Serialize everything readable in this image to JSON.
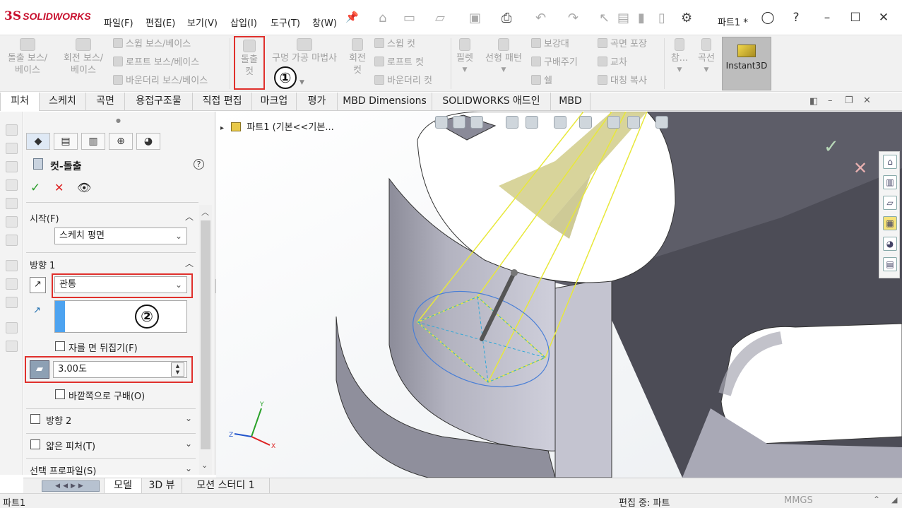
{
  "app": {
    "brand_mark": "3S",
    "brand_name": "SOLIDWORKS",
    "doc_title": "파트1 *"
  },
  "menu": [
    "파일(F)",
    "편집(E)",
    "보기(V)",
    "삽입(I)",
    "도구(T)",
    "창(W)"
  ],
  "ribbon": {
    "boss_extrude": [
      "돌출 보스/",
      "베이스"
    ],
    "boss_revolve": [
      "회전 보스/",
      "베이스"
    ],
    "sweep_boss": "스윕 보스/베이스",
    "loft_boss": "로프트 보스/베이스",
    "boundary_boss": "바운더리 보스/베이스",
    "cut_extrude": [
      "돌출",
      "컷"
    ],
    "hole_wizard": [
      "구멍 가공 마법사"
    ],
    "cut_revolve": [
      "회전",
      "컷"
    ],
    "sweep_cut": "스윕 컷",
    "loft_cut": "로프트 컷",
    "boundary_cut": "바운더리 컷",
    "fillet": "필렛",
    "linear_pattern": "선형 패턴",
    "rib": "보강대",
    "draft": "구배주기",
    "shell": "쉘",
    "wrap": "곡면 포장",
    "intersect": "교차",
    "mirror": "대칭 복사",
    "reference": "참...",
    "curves": "곡선",
    "instant3d": "Instant3D",
    "callout_1": "①"
  },
  "tabs": [
    "피처",
    "스케치",
    "곡면",
    "용접구조물",
    "직접 편집",
    "마크업",
    "평가",
    "MBD Dimensions",
    "SOLIDWORKS 애드인",
    "MBD"
  ],
  "property_manager": {
    "title": "컷-돌출",
    "start": {
      "label": "시작(F)",
      "value": "스케치 평면"
    },
    "direction1": {
      "label": "방향 1",
      "end_condition": "관통",
      "flip_side_label": "자를 면 뒤집기(F)",
      "draft_value": "3.00도",
      "draft_outward_label": "바깥쪽으로 구배(O)"
    },
    "callout_2": "②",
    "direction2_label": "방향 2",
    "thin_feature_label": "얇은 피처(T)",
    "selected_contours_label": "선택 프로파일(S)"
  },
  "tree": {
    "text": "파트1  (기본<<기본..."
  },
  "bottom_tabs": [
    "모델",
    "3D 뷰",
    "모션 스터디 1"
  ],
  "status": {
    "left": "파트1",
    "mode": "편집 중: 파트",
    "units": "MMGS"
  },
  "colors": {
    "accent_red": "#e0302c",
    "brand_red": "#c8102e",
    "part_gray": "#b9b9c6",
    "sketch_yellow": "#ffff33"
  }
}
